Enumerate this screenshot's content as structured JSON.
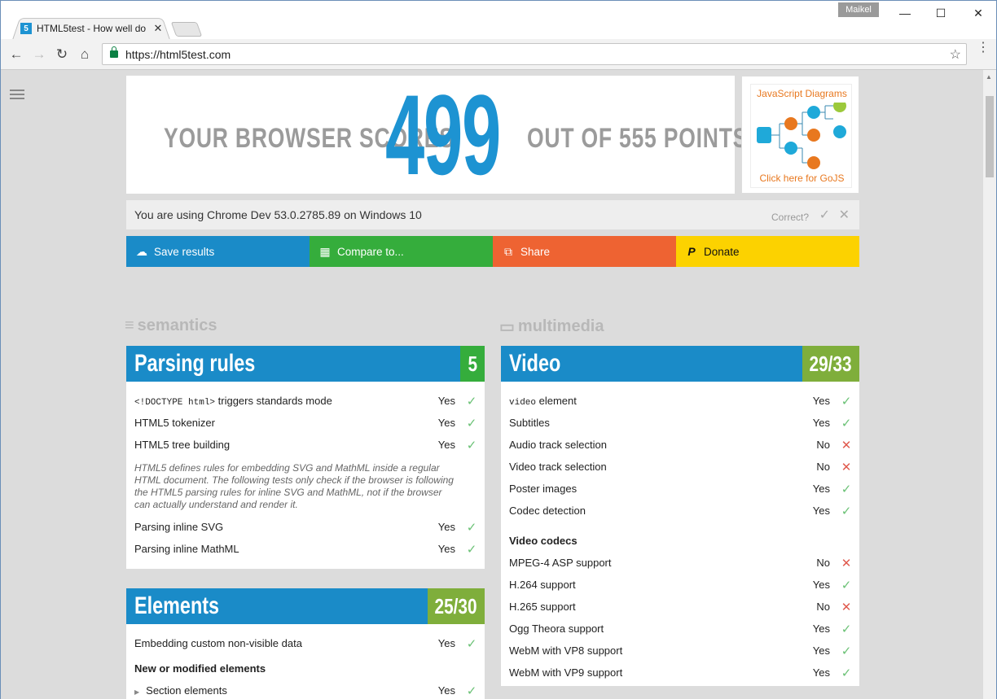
{
  "browser": {
    "tab_title": "HTML5test - How well do",
    "tab_favicon": "5",
    "user": "Maikel",
    "url": "https://html5test.com"
  },
  "score": {
    "prefix": "YOUR BROWSER SCORES",
    "value": "499",
    "suffix": "OUT OF 555 POINTS"
  },
  "ad": {
    "title": "JavaScript Diagrams",
    "cta": "Click here for GoJS"
  },
  "detect": {
    "text": "You are using Chrome Dev 53.0.2785.89 on Windows 10",
    "correct_label": "Correct?"
  },
  "actions": {
    "save": "Save results",
    "compare": "Compare to...",
    "share": "Share",
    "donate": "Donate"
  },
  "categories": {
    "left": "semantics",
    "right": "multimedia"
  },
  "parsing": {
    "title": "Parsing rules",
    "score": "5",
    "rows": [
      {
        "code": "<!DOCTYPE html>",
        "label": " triggers standards mode",
        "result": "Yes"
      },
      {
        "label": "HTML5 tokenizer",
        "result": "Yes"
      },
      {
        "label": "HTML5 tree building",
        "result": "Yes"
      }
    ],
    "note": "HTML5 defines rules for embedding SVG and MathML inside a regular HTML document. The following tests only check if the browser is following the HTML5 parsing rules for inline SVG and MathML, not if the browser can actually understand and render it.",
    "rows2": [
      {
        "label": "Parsing inline SVG",
        "result": "Yes"
      },
      {
        "label": "Parsing inline MathML",
        "result": "Yes"
      }
    ]
  },
  "elements": {
    "title": "Elements",
    "score": "25/30",
    "rows": [
      {
        "label": "Embedding custom non-visible data",
        "result": "Yes"
      }
    ],
    "subhead": "New or modified elements",
    "rows2": [
      {
        "label": "Section elements",
        "result": "Yes"
      }
    ]
  },
  "video": {
    "title": "Video",
    "score": "29/33",
    "rows": [
      {
        "code": "video",
        "label": " element",
        "result": "Yes"
      },
      {
        "label": "Subtitles",
        "result": "Yes"
      },
      {
        "label": "Audio track selection",
        "result": "No"
      },
      {
        "label": "Video track selection",
        "result": "No"
      },
      {
        "label": "Poster images",
        "result": "Yes"
      },
      {
        "label": "Codec detection",
        "result": "Yes"
      }
    ],
    "subhead": "Video codecs",
    "rows2": [
      {
        "label": "MPEG-4 ASP support",
        "result": "No"
      },
      {
        "label": "H.264 support",
        "result": "Yes"
      },
      {
        "label": "H.265 support",
        "result": "No"
      },
      {
        "label": "Ogg Theora support",
        "result": "Yes"
      },
      {
        "label": "WebM with VP8 support",
        "result": "Yes"
      },
      {
        "label": "WebM with VP9 support",
        "result": "Yes"
      }
    ]
  },
  "colors": {
    "blue": "#1a8bc8",
    "green": "#35ad3c",
    "orange": "#ee6332",
    "yellow": "#fcd200",
    "yes": "#6ac175",
    "no": "#e05a4e"
  }
}
